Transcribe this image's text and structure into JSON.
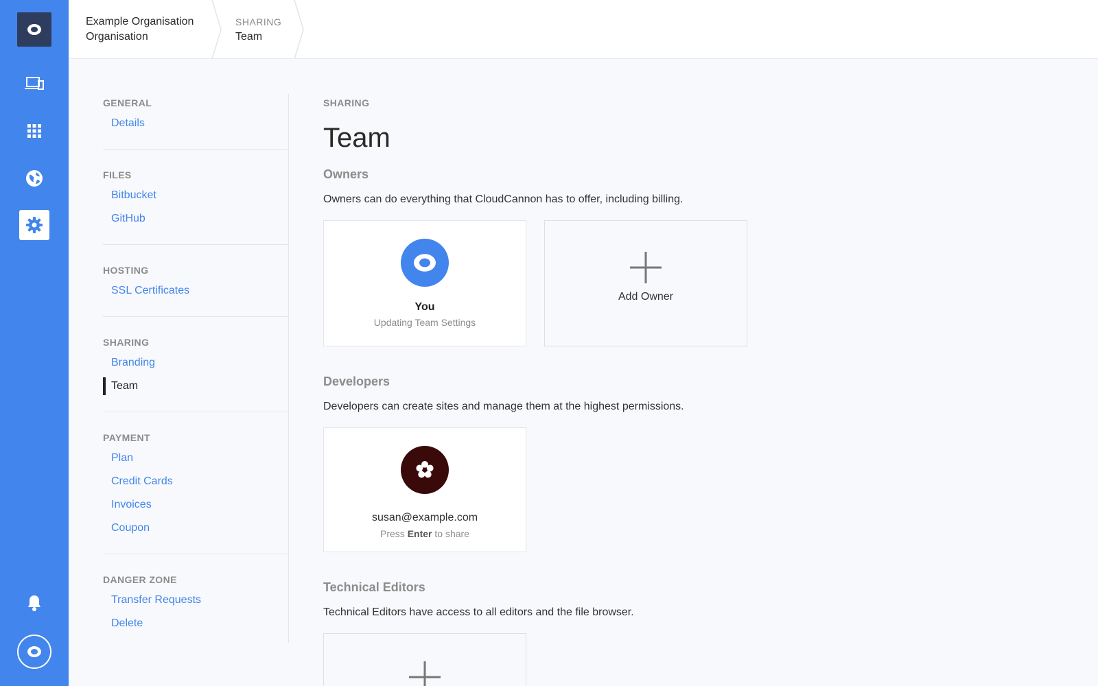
{
  "rail": {
    "logo_icon": "cloudcannon-logo-icon",
    "items": [
      {
        "icon": "devices-icon",
        "active": false
      },
      {
        "icon": "apps-grid-icon",
        "active": false
      },
      {
        "icon": "globe-icon",
        "active": false
      },
      {
        "icon": "gear-icon",
        "active": true
      }
    ],
    "bell_icon": "bell-icon",
    "avatar_icon": "user-avatar-icon"
  },
  "breadcrumb": {
    "org_name": "Example Organisation",
    "org_type": "Organisation",
    "section": "SHARING",
    "page": "Team"
  },
  "nav": {
    "groups": [
      {
        "heading": "GENERAL",
        "items": [
          "Details"
        ]
      },
      {
        "heading": "FILES",
        "items": [
          "Bitbucket",
          "GitHub"
        ]
      },
      {
        "heading": "HOSTING",
        "items": [
          "SSL Certificates"
        ]
      },
      {
        "heading": "SHARING",
        "items": [
          "Branding",
          "Team"
        ]
      },
      {
        "heading": "PAYMENT",
        "items": [
          "Plan",
          "Credit Cards",
          "Invoices",
          "Coupon"
        ]
      },
      {
        "heading": "DANGER ZONE",
        "items": [
          "Transfer Requests",
          "Delete"
        ]
      }
    ],
    "active_item": "Team"
  },
  "main": {
    "kicker": "SHARING",
    "title": "Team",
    "owners": {
      "heading": "Owners",
      "description": "Owners can do everything that CloudCannon has to offer, including billing.",
      "you_name": "You",
      "you_status": "Updating Team Settings",
      "add_label": "Add Owner"
    },
    "developers": {
      "heading": "Developers",
      "description": "Developers can create sites and manage them at the highest permissions.",
      "input_value": "susan@example.com",
      "hint_prefix": "Press",
      "hint_key": "Enter",
      "hint_suffix": "to share"
    },
    "technical_editors": {
      "heading": "Technical Editors",
      "description": "Technical Editors have access to all editors and the file browser."
    }
  },
  "colors": {
    "rail": "#4285ec",
    "link": "#4285ec",
    "owner_avatar": "#4285ec",
    "developer_avatar": "#3a0a0a"
  }
}
